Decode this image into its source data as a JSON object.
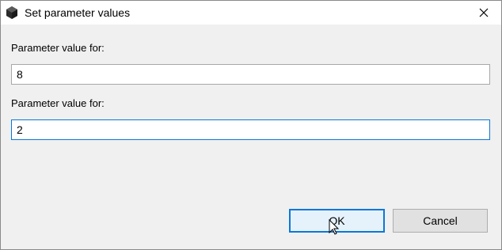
{
  "window": {
    "title": "Set parameter values",
    "app_icon": "cube-app-icon",
    "close_icon": "close-icon"
  },
  "fields": [
    {
      "label": "Parameter value for:",
      "value": "8",
      "focused": false
    },
    {
      "label": "Parameter value for:",
      "value": "2",
      "focused": true
    }
  ],
  "buttons": {
    "ok_label": "OK",
    "cancel_label": "Cancel"
  },
  "colors": {
    "accent": "#0a78d7",
    "dialog_bg": "#f0f0f0",
    "button_bg": "#e1e1e1"
  }
}
